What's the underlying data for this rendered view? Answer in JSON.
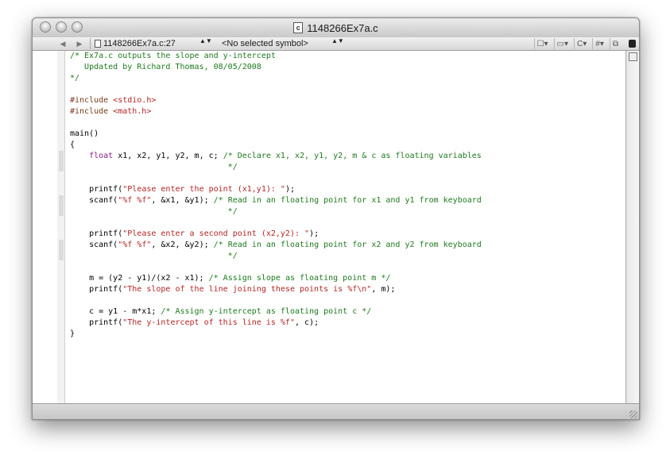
{
  "window": {
    "title": "1148266Ex7a.c",
    "file_icon_glyph": "c"
  },
  "navbar": {
    "back_glyph": "◀",
    "forward_glyph": "▶",
    "file_location": "1148266Ex7a.c:27",
    "symbol": "<No selected symbol>",
    "stepper_glyph": "▲▼",
    "tools": [
      "☐▾",
      "▭▾",
      "C▾",
      "#▾",
      "⧉"
    ]
  },
  "code_lines": [
    [
      {
        "t": "/* Ex7a.c outputs the slope and y-intercept",
        "c": "cm"
      }
    ],
    [
      {
        "t": "   Updated by Richard Thomas, 08/05/2008",
        "c": "cm"
      }
    ],
    [
      {
        "t": "*/",
        "c": "cm"
      }
    ],
    [],
    [
      {
        "t": "#include ",
        "c": "pp"
      },
      {
        "t": "<stdio.h>",
        "c": "s"
      }
    ],
    [
      {
        "t": "#include ",
        "c": "pp"
      },
      {
        "t": "<math.h>",
        "c": "s"
      }
    ],
    [],
    [
      {
        "t": "main()",
        "c": ""
      }
    ],
    [
      {
        "t": "{",
        "c": ""
      }
    ],
    [
      {
        "t": "    ",
        "c": ""
      },
      {
        "t": "float",
        "c": "k"
      },
      {
        "t": " x1, x2, y1, y2, m, c; ",
        "c": ""
      },
      {
        "t": "/* Declare x1, x2, y1, y2, m & c as floating variables",
        "c": "cm"
      }
    ],
    [
      {
        "t": "                                 */",
        "c": "cm"
      }
    ],
    [],
    [
      {
        "t": "    printf(",
        "c": ""
      },
      {
        "t": "\"Please enter the point (x1,y1): \"",
        "c": "s"
      },
      {
        "t": ");",
        "c": ""
      }
    ],
    [
      {
        "t": "    scanf(",
        "c": ""
      },
      {
        "t": "\"%f %f\"",
        "c": "s"
      },
      {
        "t": ", &x1, &y1); ",
        "c": ""
      },
      {
        "t": "/* Read in an floating point for x1 and y1 from keyboard",
        "c": "cm"
      }
    ],
    [
      {
        "t": "                                 */",
        "c": "cm"
      }
    ],
    [],
    [
      {
        "t": "    printf(",
        "c": ""
      },
      {
        "t": "\"Please enter a second point (x2,y2): \"",
        "c": "s"
      },
      {
        "t": ");",
        "c": ""
      }
    ],
    [
      {
        "t": "    scanf(",
        "c": ""
      },
      {
        "t": "\"%f %f\"",
        "c": "s"
      },
      {
        "t": ", &x2, &y2); ",
        "c": ""
      },
      {
        "t": "/* Read in an floating point for x2 and y2 from keyboard",
        "c": "cm"
      }
    ],
    [
      {
        "t": "                                 */",
        "c": "cm"
      }
    ],
    [],
    [
      {
        "t": "    m = (y2 - y1)/(x2 - x1); ",
        "c": ""
      },
      {
        "t": "/* Assign slope as floating point m */",
        "c": "cm"
      }
    ],
    [
      {
        "t": "    printf(",
        "c": ""
      },
      {
        "t": "\"The slope of the line joining these points is %f\\n\"",
        "c": "s"
      },
      {
        "t": ", m);",
        "c": ""
      }
    ],
    [],
    [
      {
        "t": "    c = y1 - m*x1; ",
        "c": ""
      },
      {
        "t": "/* Assign y-intercept as floating point c */",
        "c": "cm"
      }
    ],
    [
      {
        "t": "    printf(",
        "c": ""
      },
      {
        "t": "\"The y-intercept of this line is %f\"",
        "c": "s"
      },
      {
        "t": ", c);",
        "c": ""
      }
    ],
    [
      {
        "t": "}",
        "c": ""
      }
    ]
  ],
  "fold_marker_lines": [
    9,
    13,
    17
  ]
}
